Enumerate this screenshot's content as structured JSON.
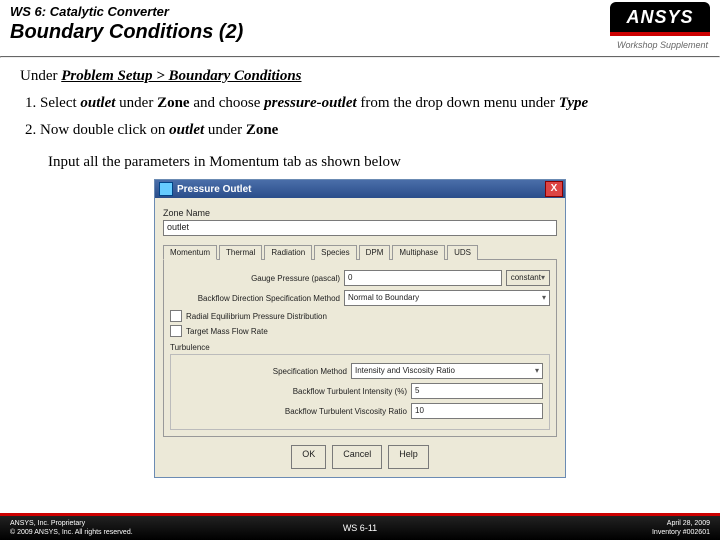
{
  "header": {
    "ws": "WS 6: Catalytic Converter",
    "title": "Boundary Conditions (2)",
    "logo": "ANSYS",
    "sup": "Workshop Supplement"
  },
  "body": {
    "lead_prefix": "Under ",
    "lead_path": "Problem Setup > Boundary Conditions",
    "step1_a": "Select ",
    "step1_b": "outlet",
    "step1_c": " under ",
    "step1_d": "Zone",
    "step1_e": " and choose ",
    "step1_f": "pressure-outlet",
    "step1_g": " from the drop down menu under ",
    "step1_h": "Type",
    "step2_a": "Now double click on ",
    "step2_b": "outlet",
    "step2_c": " under ",
    "step2_d": "Zone",
    "after": "Input all the parameters in Momentum tab as shown below"
  },
  "dialog": {
    "title": "Pressure Outlet",
    "close": "X",
    "zone_label": "Zone Name",
    "zone_value": "outlet",
    "tabs": [
      "Momentum",
      "Thermal",
      "Radiation",
      "Species",
      "DPM",
      "Multiphase",
      "UDS"
    ],
    "gauge_label": "Gauge Pressure (pascal)",
    "gauge_value": "0",
    "gauge_unit": "constant",
    "dir_label": "Backflow Direction Specification Method",
    "dir_value": "Normal to Boundary",
    "chk1": "Radial Equilibrium Pressure Distribution",
    "chk2": "Target Mass Flow Rate",
    "turb_label": "Turbulence",
    "spec_label": "Specification Method",
    "spec_value": "Intensity and Viscosity Ratio",
    "ti_label": "Backflow Turbulent Intensity (%)",
    "ti_value": "5",
    "tvr_label": "Backflow Turbulent Viscosity Ratio",
    "tvr_value": "10",
    "ok": "OK",
    "cancel": "Cancel",
    "help": "Help"
  },
  "footer": {
    "l1": "ANSYS, Inc. Proprietary",
    "l2": "© 2009 ANSYS, Inc. All rights reserved.",
    "center": "WS 6-11",
    "r1": "April 28, 2009",
    "r2": "Inventory #002601"
  }
}
